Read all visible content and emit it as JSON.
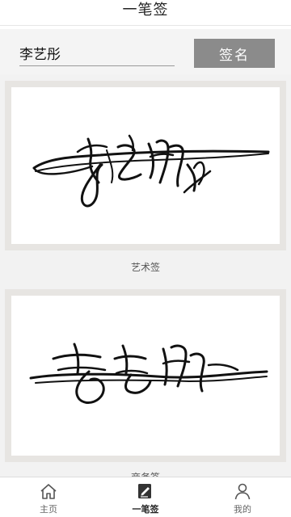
{
  "header": {
    "title": "一笔签"
  },
  "form": {
    "name_value": "李艺彤",
    "sign_button_label": "签名"
  },
  "cards": [
    {
      "label": "艺术签"
    },
    {
      "label": "商务签"
    }
  ],
  "tabbar": {
    "items": [
      {
        "label": "主页",
        "icon": "home-icon",
        "active": false
      },
      {
        "label": "一笔签",
        "icon": "signature-pen-icon",
        "active": true
      },
      {
        "label": "我的",
        "icon": "user-icon",
        "active": false
      }
    ]
  }
}
